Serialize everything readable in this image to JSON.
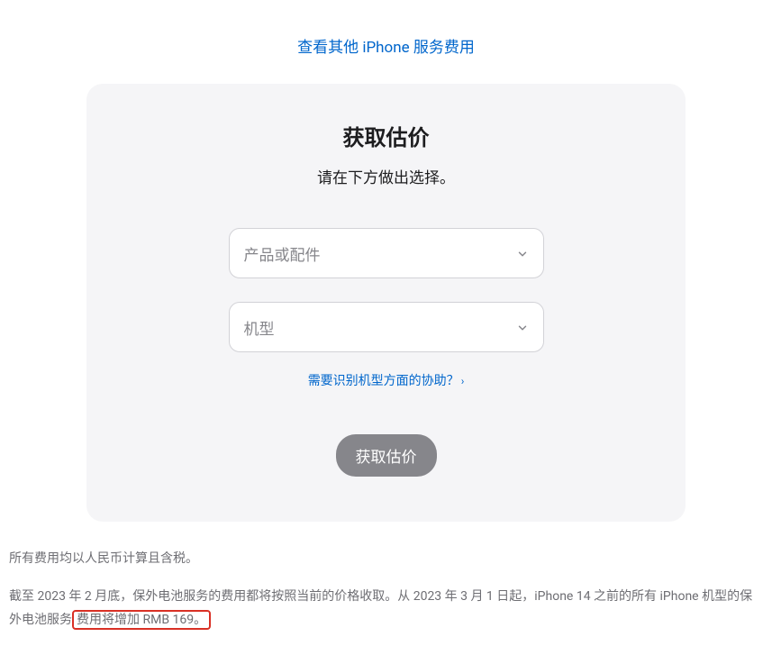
{
  "topLink": {
    "label": "查看其他 iPhone 服务费用"
  },
  "card": {
    "title": "获取估价",
    "subtitle": "请在下方做出选择。",
    "select1": {
      "placeholder": "产品或配件"
    },
    "select2": {
      "placeholder": "机型"
    },
    "helpLink": {
      "label": "需要识别机型方面的协助？"
    },
    "submit": {
      "label": "获取估价"
    }
  },
  "footer": {
    "line1": "所有费用均以人民币计算且含税。",
    "line2_part1": "截至 2023 年 2 月底，保外电池服务的费用都将按照当前的价格收取。从 2023 年 3 月 1 日起，iPhone 14 之前的所有 iPhone 机型的保外电池服务",
    "line2_part2": "费用将增加 RMB 169。"
  }
}
